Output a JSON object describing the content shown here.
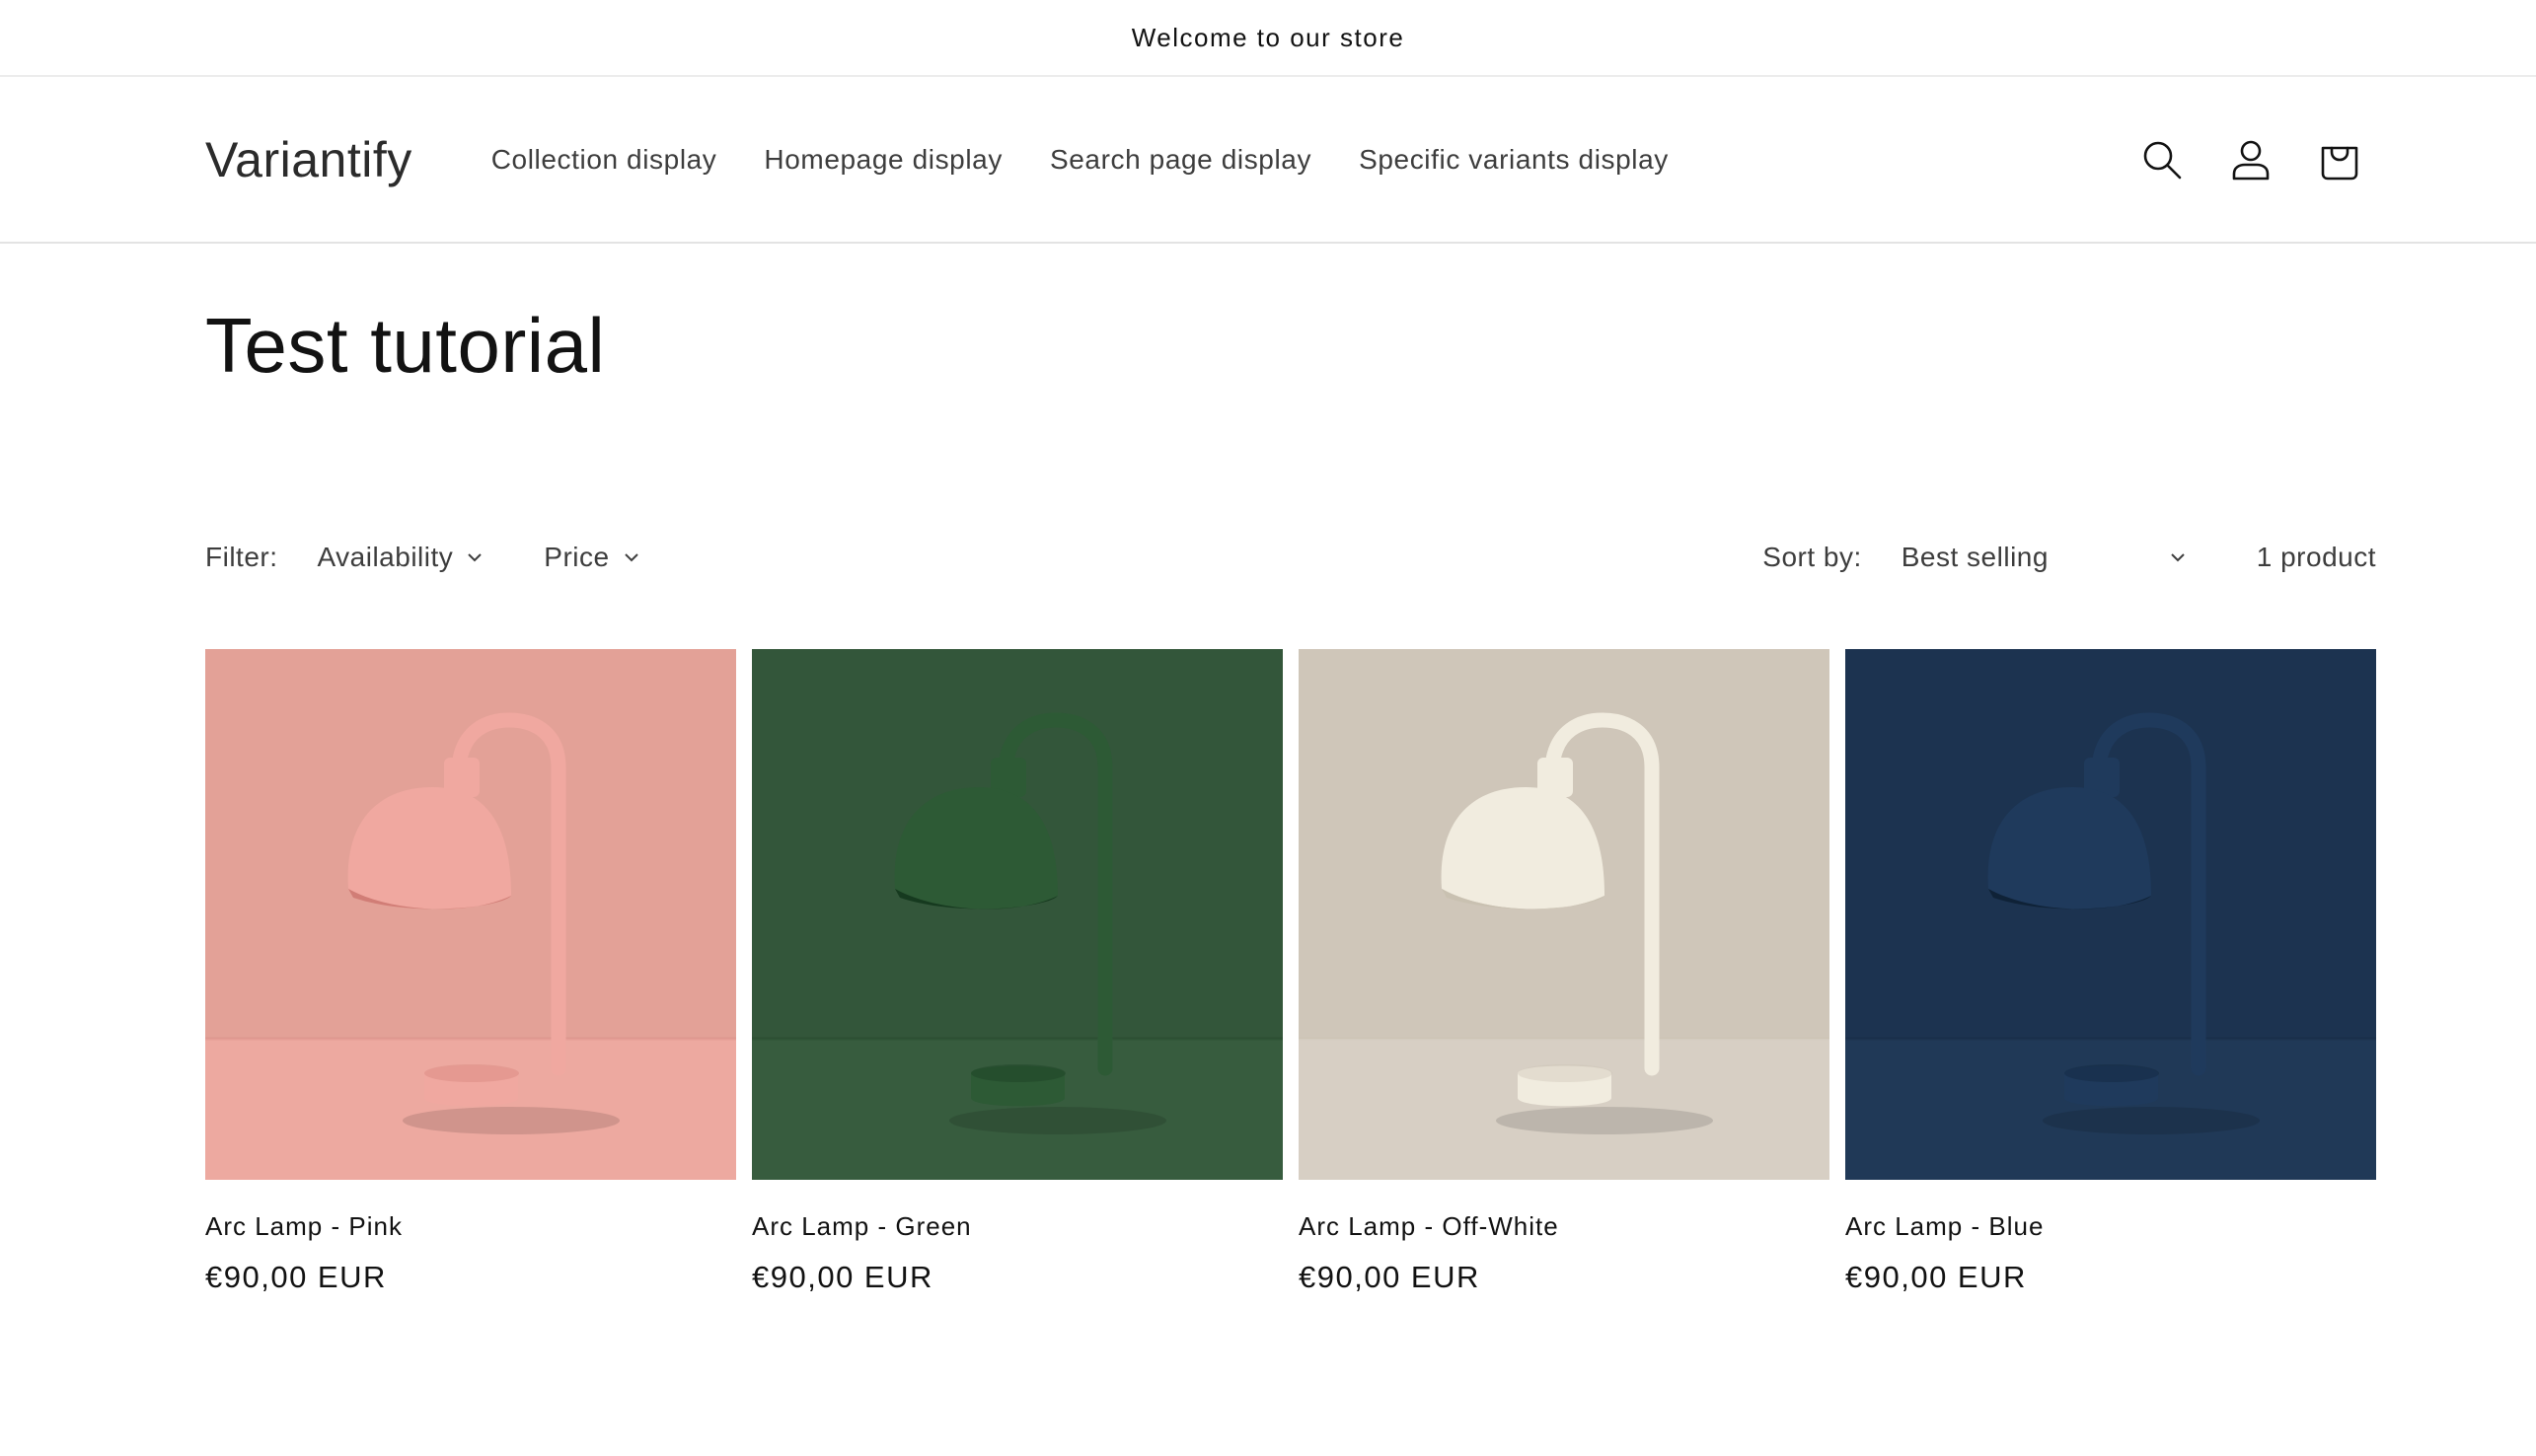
{
  "announcement": {
    "text": "Welcome to our store"
  },
  "header": {
    "logo": "Variantify",
    "nav": [
      {
        "label": "Collection display"
      },
      {
        "label": "Homepage display"
      },
      {
        "label": "Search page display"
      },
      {
        "label": "Specific variants display"
      }
    ],
    "icons": [
      "search-icon",
      "account-icon",
      "cart-icon"
    ]
  },
  "page": {
    "title": "Test tutorial"
  },
  "toolbar": {
    "filter_label": "Filter:",
    "filters": [
      {
        "label": "Availability"
      },
      {
        "label": "Price"
      }
    ],
    "sort_label": "Sort by:",
    "sort_value": "Best selling",
    "product_count": "1 product"
  },
  "products": [
    {
      "title": "Arc Lamp - Pink",
      "price": "€90,00 EUR",
      "colors": {
        "wall": "#e3a197",
        "floor": "#eda9a0",
        "lamp": "#f0a8a0",
        "lamp_dark": "#d17d76"
      }
    },
    {
      "title": "Arc Lamp - Green",
      "price": "€90,00 EUR",
      "colors": {
        "wall": "#33563a",
        "floor": "#375c3e",
        "lamp": "#2d5a35",
        "lamp_dark": "#163a1f"
      }
    },
    {
      "title": "Arc Lamp - Off-White",
      "price": "€90,00 EUR",
      "colors": {
        "wall": "#cfc6b9",
        "floor": "#d7cfc4",
        "lamp": "#f1ecdf",
        "lamp_dark": "#c9c1b1"
      }
    },
    {
      "title": "Arc Lamp - Blue",
      "price": "€90,00 EUR",
      "colors": {
        "wall": "#1c3350",
        "floor": "#203957",
        "lamp": "#1f3a5c",
        "lamp_dark": "#0f2237"
      }
    }
  ]
}
